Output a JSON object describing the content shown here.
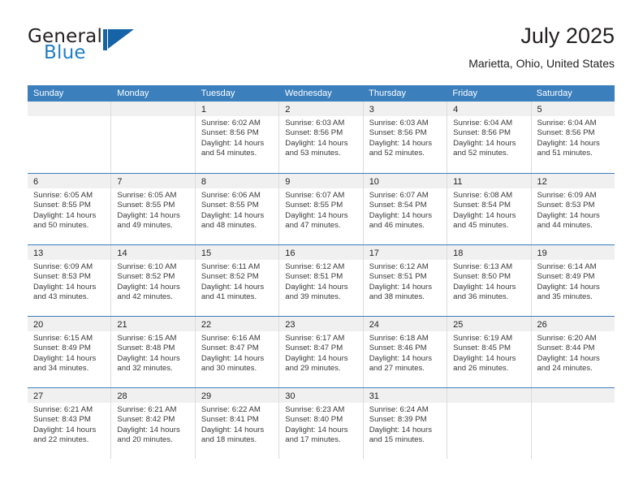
{
  "brand": {
    "name_part1": "General",
    "name_part2": "Blue",
    "logo_icon": "triangle-flag-icon"
  },
  "header": {
    "title": "July 2025",
    "location": "Marietta, Ohio, United States"
  },
  "calendar": {
    "weekdays": [
      "Sunday",
      "Monday",
      "Tuesday",
      "Wednesday",
      "Thursday",
      "Friday",
      "Saturday"
    ],
    "accent_color": "#3b7fbd",
    "daynum_band_color": "#f0f0f0",
    "weeks": [
      [
        {
          "day": "",
          "sunrise": "",
          "sunset": "",
          "daylight_line1": "",
          "daylight_line2": ""
        },
        {
          "day": "",
          "sunrise": "",
          "sunset": "",
          "daylight_line1": "",
          "daylight_line2": ""
        },
        {
          "day": "1",
          "sunrise": "Sunrise: 6:02 AM",
          "sunset": "Sunset: 8:56 PM",
          "daylight_line1": "Daylight: 14 hours",
          "daylight_line2": "and 54 minutes."
        },
        {
          "day": "2",
          "sunrise": "Sunrise: 6:03 AM",
          "sunset": "Sunset: 8:56 PM",
          "daylight_line1": "Daylight: 14 hours",
          "daylight_line2": "and 53 minutes."
        },
        {
          "day": "3",
          "sunrise": "Sunrise: 6:03 AM",
          "sunset": "Sunset: 8:56 PM",
          "daylight_line1": "Daylight: 14 hours",
          "daylight_line2": "and 52 minutes."
        },
        {
          "day": "4",
          "sunrise": "Sunrise: 6:04 AM",
          "sunset": "Sunset: 8:56 PM",
          "daylight_line1": "Daylight: 14 hours",
          "daylight_line2": "and 52 minutes."
        },
        {
          "day": "5",
          "sunrise": "Sunrise: 6:04 AM",
          "sunset": "Sunset: 8:56 PM",
          "daylight_line1": "Daylight: 14 hours",
          "daylight_line2": "and 51 minutes."
        }
      ],
      [
        {
          "day": "6",
          "sunrise": "Sunrise: 6:05 AM",
          "sunset": "Sunset: 8:55 PM",
          "daylight_line1": "Daylight: 14 hours",
          "daylight_line2": "and 50 minutes."
        },
        {
          "day": "7",
          "sunrise": "Sunrise: 6:05 AM",
          "sunset": "Sunset: 8:55 PM",
          "daylight_line1": "Daylight: 14 hours",
          "daylight_line2": "and 49 minutes."
        },
        {
          "day": "8",
          "sunrise": "Sunrise: 6:06 AM",
          "sunset": "Sunset: 8:55 PM",
          "daylight_line1": "Daylight: 14 hours",
          "daylight_line2": "and 48 minutes."
        },
        {
          "day": "9",
          "sunrise": "Sunrise: 6:07 AM",
          "sunset": "Sunset: 8:55 PM",
          "daylight_line1": "Daylight: 14 hours",
          "daylight_line2": "and 47 minutes."
        },
        {
          "day": "10",
          "sunrise": "Sunrise: 6:07 AM",
          "sunset": "Sunset: 8:54 PM",
          "daylight_line1": "Daylight: 14 hours",
          "daylight_line2": "and 46 minutes."
        },
        {
          "day": "11",
          "sunrise": "Sunrise: 6:08 AM",
          "sunset": "Sunset: 8:54 PM",
          "daylight_line1": "Daylight: 14 hours",
          "daylight_line2": "and 45 minutes."
        },
        {
          "day": "12",
          "sunrise": "Sunrise: 6:09 AM",
          "sunset": "Sunset: 8:53 PM",
          "daylight_line1": "Daylight: 14 hours",
          "daylight_line2": "and 44 minutes."
        }
      ],
      [
        {
          "day": "13",
          "sunrise": "Sunrise: 6:09 AM",
          "sunset": "Sunset: 8:53 PM",
          "daylight_line1": "Daylight: 14 hours",
          "daylight_line2": "and 43 minutes."
        },
        {
          "day": "14",
          "sunrise": "Sunrise: 6:10 AM",
          "sunset": "Sunset: 8:52 PM",
          "daylight_line1": "Daylight: 14 hours",
          "daylight_line2": "and 42 minutes."
        },
        {
          "day": "15",
          "sunrise": "Sunrise: 6:11 AM",
          "sunset": "Sunset: 8:52 PM",
          "daylight_line1": "Daylight: 14 hours",
          "daylight_line2": "and 41 minutes."
        },
        {
          "day": "16",
          "sunrise": "Sunrise: 6:12 AM",
          "sunset": "Sunset: 8:51 PM",
          "daylight_line1": "Daylight: 14 hours",
          "daylight_line2": "and 39 minutes."
        },
        {
          "day": "17",
          "sunrise": "Sunrise: 6:12 AM",
          "sunset": "Sunset: 8:51 PM",
          "daylight_line1": "Daylight: 14 hours",
          "daylight_line2": "and 38 minutes."
        },
        {
          "day": "18",
          "sunrise": "Sunrise: 6:13 AM",
          "sunset": "Sunset: 8:50 PM",
          "daylight_line1": "Daylight: 14 hours",
          "daylight_line2": "and 36 minutes."
        },
        {
          "day": "19",
          "sunrise": "Sunrise: 6:14 AM",
          "sunset": "Sunset: 8:49 PM",
          "daylight_line1": "Daylight: 14 hours",
          "daylight_line2": "and 35 minutes."
        }
      ],
      [
        {
          "day": "20",
          "sunrise": "Sunrise: 6:15 AM",
          "sunset": "Sunset: 8:49 PM",
          "daylight_line1": "Daylight: 14 hours",
          "daylight_line2": "and 34 minutes."
        },
        {
          "day": "21",
          "sunrise": "Sunrise: 6:15 AM",
          "sunset": "Sunset: 8:48 PM",
          "daylight_line1": "Daylight: 14 hours",
          "daylight_line2": "and 32 minutes."
        },
        {
          "day": "22",
          "sunrise": "Sunrise: 6:16 AM",
          "sunset": "Sunset: 8:47 PM",
          "daylight_line1": "Daylight: 14 hours",
          "daylight_line2": "and 30 minutes."
        },
        {
          "day": "23",
          "sunrise": "Sunrise: 6:17 AM",
          "sunset": "Sunset: 8:47 PM",
          "daylight_line1": "Daylight: 14 hours",
          "daylight_line2": "and 29 minutes."
        },
        {
          "day": "24",
          "sunrise": "Sunrise: 6:18 AM",
          "sunset": "Sunset: 8:46 PM",
          "daylight_line1": "Daylight: 14 hours",
          "daylight_line2": "and 27 minutes."
        },
        {
          "day": "25",
          "sunrise": "Sunrise: 6:19 AM",
          "sunset": "Sunset: 8:45 PM",
          "daylight_line1": "Daylight: 14 hours",
          "daylight_line2": "and 26 minutes."
        },
        {
          "day": "26",
          "sunrise": "Sunrise: 6:20 AM",
          "sunset": "Sunset: 8:44 PM",
          "daylight_line1": "Daylight: 14 hours",
          "daylight_line2": "and 24 minutes."
        }
      ],
      [
        {
          "day": "27",
          "sunrise": "Sunrise: 6:21 AM",
          "sunset": "Sunset: 8:43 PM",
          "daylight_line1": "Daylight: 14 hours",
          "daylight_line2": "and 22 minutes."
        },
        {
          "day": "28",
          "sunrise": "Sunrise: 6:21 AM",
          "sunset": "Sunset: 8:42 PM",
          "daylight_line1": "Daylight: 14 hours",
          "daylight_line2": "and 20 minutes."
        },
        {
          "day": "29",
          "sunrise": "Sunrise: 6:22 AM",
          "sunset": "Sunset: 8:41 PM",
          "daylight_line1": "Daylight: 14 hours",
          "daylight_line2": "and 18 minutes."
        },
        {
          "day": "30",
          "sunrise": "Sunrise: 6:23 AM",
          "sunset": "Sunset: 8:40 PM",
          "daylight_line1": "Daylight: 14 hours",
          "daylight_line2": "and 17 minutes."
        },
        {
          "day": "31",
          "sunrise": "Sunrise: 6:24 AM",
          "sunset": "Sunset: 8:39 PM",
          "daylight_line1": "Daylight: 14 hours",
          "daylight_line2": "and 15 minutes."
        },
        {
          "day": "",
          "sunrise": "",
          "sunset": "",
          "daylight_line1": "",
          "daylight_line2": ""
        },
        {
          "day": "",
          "sunrise": "",
          "sunset": "",
          "daylight_line1": "",
          "daylight_line2": ""
        }
      ]
    ]
  }
}
